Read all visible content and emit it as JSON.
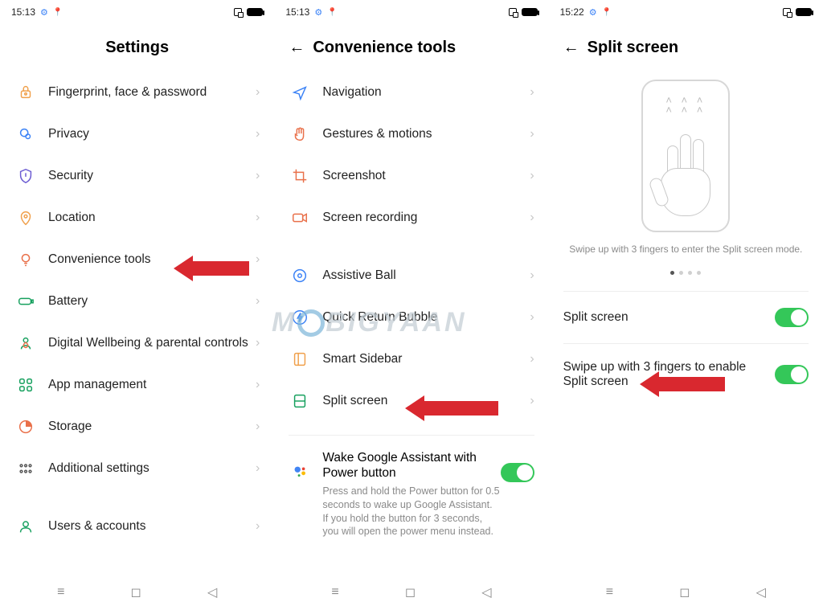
{
  "screens": {
    "s1": {
      "status_time": "15:13",
      "title": "Settings",
      "items": [
        "Fingerprint, face & password",
        "Privacy",
        "Security",
        "Location",
        "Convenience tools",
        "Battery",
        "Digital Wellbeing & parental controls",
        "App management",
        "Storage",
        "Additional settings",
        "Users & accounts"
      ]
    },
    "s2": {
      "status_time": "15:13",
      "title": "Convenience tools",
      "group1": [
        "Navigation",
        "Gestures & motions",
        "Screenshot",
        "Screen recording"
      ],
      "group2": [
        "Assistive Ball",
        "Quick Return Bubble",
        "Smart Sidebar",
        "Split screen"
      ],
      "assist_title": "Wake Google Assistant with Power button",
      "assist_sub": "Press and hold the Power button for 0.5 seconds to wake up Google Assistant. If you hold the button for 3 seconds, you will open the power menu instead."
    },
    "s3": {
      "status_time": "15:22",
      "title": "Split screen",
      "caption": "Swipe up with 3 fingers to enter the Split screen mode.",
      "toggle1": "Split screen",
      "toggle2": "Swipe up with 3 fingers to enable Split screen"
    }
  },
  "watermark_head": "M",
  "watermark_tail": "BIGYAAN"
}
